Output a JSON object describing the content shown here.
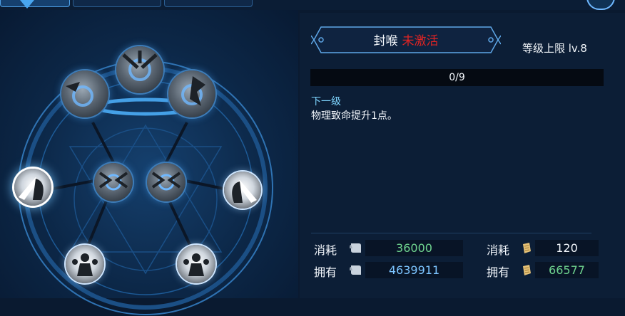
{
  "skill": {
    "name": "封喉",
    "state": "未激活",
    "level_limit": "等级上限 lv.8",
    "progress_text": "0/9",
    "progress_fraction": 0,
    "next_label": "下一级",
    "next_desc": "物理致命提升1点。"
  },
  "resources": {
    "cost_label": "消耗",
    "own_label": "拥有",
    "left": {
      "icon": "scroll-icon",
      "cost": "36000",
      "own": "4639911"
    },
    "right": {
      "icon": "paper-roll-icon",
      "cost": "120",
      "own": "66577"
    }
  },
  "colors": {
    "inactive_state": "#e02424",
    "cost_green": "#6fd48f",
    "own_blue": "#7cc4ff",
    "progress_fill": "#2b8ed8"
  }
}
